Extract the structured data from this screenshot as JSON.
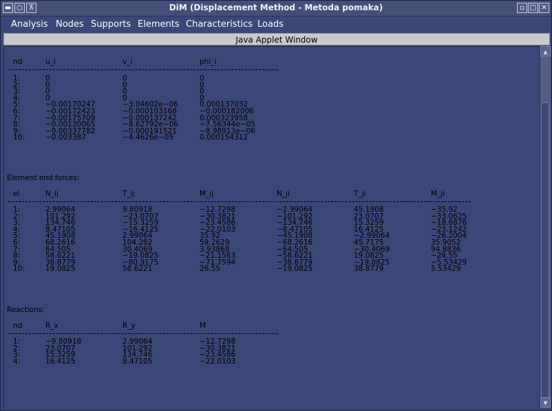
{
  "window": {
    "title": "DiM (Displacement Method - Metoda pomaka)"
  },
  "menu": [
    "Analysis",
    "Nodes",
    "Supports",
    "Elements",
    "Characteristics",
    "Loads"
  ],
  "applet_label": "Java Applet Window",
  "displacements": {
    "headers": [
      "nd",
      "u_i",
      "v_i",
      "phi_i"
    ],
    "rows": [
      [
        "1:",
        "0",
        "0",
        "0"
      ],
      [
        "2:",
        "0",
        "0",
        "0"
      ],
      [
        "3:",
        "0",
        "0",
        "0"
      ],
      [
        "4:",
        "0",
        "0",
        "0"
      ],
      [
        "5:",
        "−0.00170247",
        "−3.04602e−06",
        "0.000137032"
      ],
      [
        "6:",
        "−0.00172423",
        "−0.000103168",
        "−0.000182006"
      ],
      [
        "7:",
        "−0.00175709",
        "−0.000137242",
        "0.000323958"
      ],
      [
        "8:",
        "−0.00130065",
        "−8.62792e−06",
        "−7.56344e−05"
      ],
      [
        "9:",
        "−0.00337782",
        "−0.000191521",
        "−8.98913e−06"
      ],
      [
        "10:",
        "−0.003387",
        "−4.4626e−05",
        "0.000154312"
      ]
    ]
  },
  "forces": {
    "title": "Element end forces:",
    "headers": [
      "el",
      "N_ij",
      "T_ij",
      "M_ij",
      "N_ji",
      "T_ji",
      "M_ji"
    ],
    "rows": [
      [
        "1:",
        "2.99064",
        "9.80918",
        "−12.7298",
        "−2.99064",
        "45.1908",
        "−35.92"
      ],
      [
        "2:",
        "101.292",
        "−23.0707",
        "−30.3821",
        "−101.292",
        "23.0707",
        "−33.0625"
      ],
      [
        "3:",
        "134.746",
        "−15.3259",
        "−23.4586",
        "−134.746",
        "15.3259",
        "−18.6876"
      ],
      [
        "4:",
        "8.47105",
        "−16.4125",
        "−22.0103",
        "−8.47105",
        "16.4125",
        "−23.1242"
      ],
      [
        "5:",
        "45.1908",
        "2.99064",
        "35.92",
        "−45.1908",
        "−2.99064",
        "−26.2004"
      ],
      [
        "6:",
        "68.2616",
        "104.282",
        "59.2629",
        "−68.2616",
        "45.7175",
        "35.9052"
      ],
      [
        "7:",
        "64.505",
        "30.4069",
        "3.93868",
        "−64.505",
        "−30.4069",
        "94.8836"
      ],
      [
        "8:",
        "58.6221",
        "−19.0825",
        "−21.1563",
        "−58.6221",
        "19.0825",
        "−26.55"
      ],
      [
        "9:",
        "38.8779",
        "−80.9175",
        "−71.7594",
        "−38.8779",
        "−19.0825",
        "−5.53429"
      ],
      [
        "10:",
        "19.0825",
        "58.6221",
        "26.55",
        "−19.0825",
        "38.8779",
        "5.53429"
      ]
    ]
  },
  "reactions": {
    "title": "Reactions:",
    "headers": [
      "nd",
      "R_x",
      "R_y",
      "M"
    ],
    "rows": [
      [
        "1:",
        "−9.80918",
        "2.99064",
        "−12.7298"
      ],
      [
        "2:",
        "23.0707",
        "101.292",
        "−30.3821"
      ],
      [
        "3:",
        "15.3259",
        "134.746",
        "−23.4586"
      ],
      [
        "4:",
        "16.4125",
        "8.47105",
        "−22.0103"
      ]
    ]
  },
  "icons": [
    "window-menu-icon",
    "minimize-icon",
    "maximize-icon",
    "iconify-icon",
    "maximize-icon",
    "close-icon",
    "scroll-up-icon",
    "scroll-down-icon"
  ]
}
